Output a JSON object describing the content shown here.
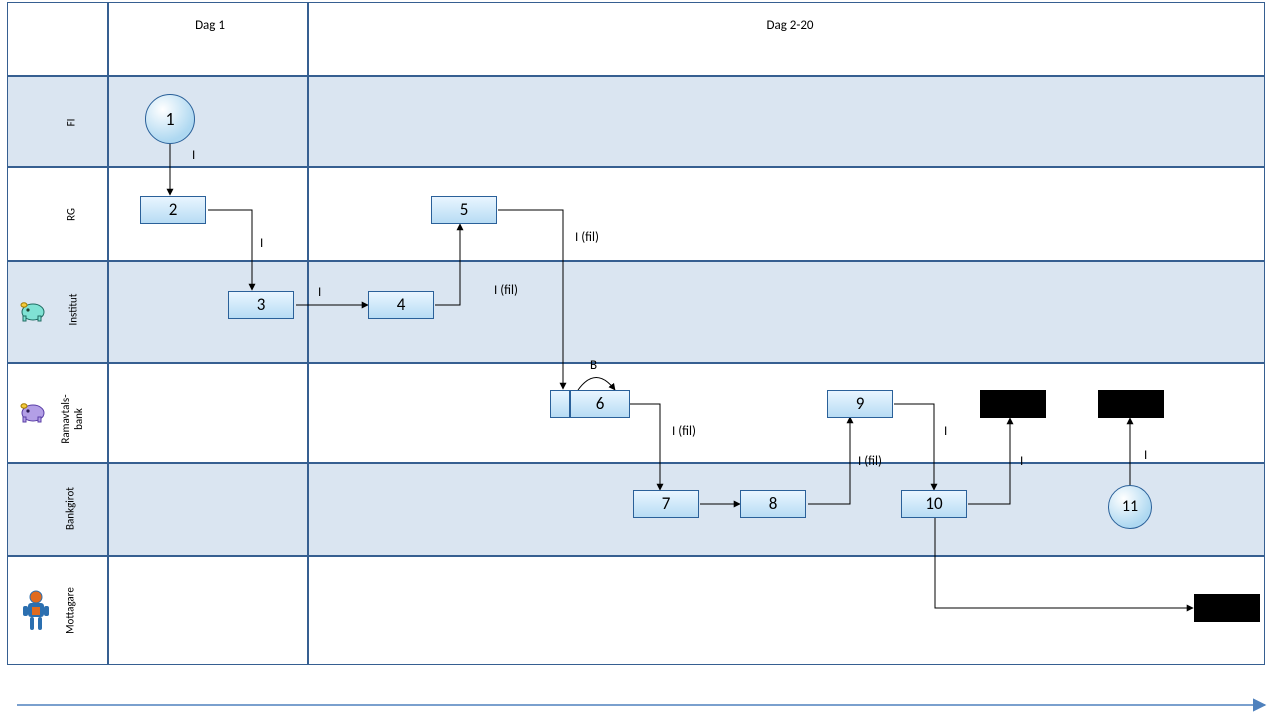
{
  "columns": {
    "c1": "Dag 1",
    "c2": "Dag 2-20"
  },
  "lanes": {
    "l1": "FI",
    "l2": "RG",
    "l3": "Institut",
    "l4": "Ramavtals-\nbank",
    "l5": "Bankgirot",
    "l6": "Mottagare"
  },
  "nodes": {
    "n1": "1",
    "n2": "2",
    "n3": "3",
    "n4": "4",
    "n5": "5",
    "n6": "6",
    "n7": "7",
    "n8": "8",
    "n9": "9",
    "n10": "10",
    "n11": "11"
  },
  "edges": {
    "e1_2": "I",
    "e2_3": "I",
    "e3_4": "I",
    "e4_5": "I (fil)",
    "e5_6": "I (fil)",
    "e6_6": "B",
    "e6_7": "I (fil)",
    "e8_9": "I (fil)",
    "e9_10": "I",
    "e10_black1": "I",
    "e11_black2": "I"
  }
}
